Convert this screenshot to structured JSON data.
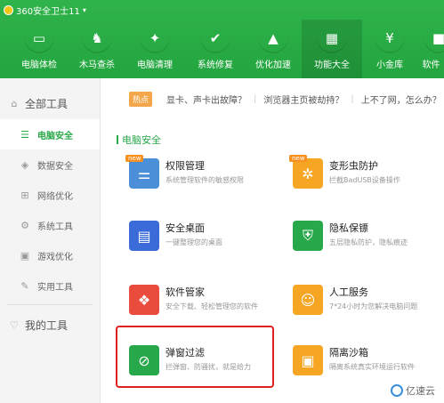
{
  "app": {
    "title": "360安全卫士11"
  },
  "nav": [
    {
      "label": "电脑体检",
      "icon": "monitor-icon",
      "color": "#4da3e8"
    },
    {
      "label": "木马查杀",
      "icon": "horse-icon",
      "color": "#8b6ad8"
    },
    {
      "label": "电脑清理",
      "icon": "broom-icon",
      "color": "#f6a623"
    },
    {
      "label": "系统修复",
      "icon": "shield-check-icon",
      "color": "#27a84a"
    },
    {
      "label": "优化加速",
      "icon": "rocket-icon",
      "color": "#3d8fe8"
    },
    {
      "label": "功能大全",
      "icon": "grid-icon",
      "color": "#f15a3a",
      "active": true
    },
    {
      "label": "小金库",
      "icon": "coin-icon",
      "color": "#f6a623"
    },
    {
      "label": "软件",
      "icon": "software-icon",
      "color": "#f15a3a"
    }
  ],
  "sidebar": {
    "all_tools": "全部工具",
    "items": [
      {
        "label": "电脑安全",
        "icon": "list-icon",
        "active": true
      },
      {
        "label": "数据安全",
        "icon": "shield-icon"
      },
      {
        "label": "网络优化",
        "icon": "network-icon"
      },
      {
        "label": "系统工具",
        "icon": "gear-icon"
      },
      {
        "label": "游戏优化",
        "icon": "gamepad-icon"
      },
      {
        "label": "实用工具",
        "icon": "wrench-icon"
      }
    ],
    "my_tools": "我的工具"
  },
  "hotbar": {
    "tag": "热点",
    "links": [
      "显卡、声卡出故障？",
      "浏览器主页被劫持？",
      "上不了网，怎么办？"
    ]
  },
  "section": {
    "title": "电脑安全"
  },
  "tools": [
    {
      "name": "权限管理",
      "desc": "系统管理软件的敏感权限",
      "icon": "permission-icon",
      "color": "#4a8fd8",
      "badge": "new"
    },
    {
      "name": "变形虫防护",
      "desc": "拦截BadUSB设备操作",
      "icon": "amoeba-icon",
      "color": "#f6a623",
      "badge": "new"
    },
    {
      "name": "安全桌面",
      "desc": "一键整理您的桌面",
      "icon": "desktop-icon",
      "color": "#3a6bd8"
    },
    {
      "name": "隐私保镖",
      "desc": "五层隐私防护，隐私痕迹",
      "icon": "privacy-icon",
      "color": "#27a84a"
    },
    {
      "name": "软件管家",
      "desc": "安全下载、轻松管理您的软件",
      "icon": "software-manager-icon",
      "color": "#e94b3c"
    },
    {
      "name": "人工服务",
      "desc": "7*24小时为您解决电脑问题",
      "icon": "agent-icon",
      "color": "#f6a623"
    },
    {
      "name": "弹窗过滤",
      "desc": "拦弹窗、防骚扰，就是给力",
      "icon": "popup-filter-icon",
      "color": "#27a84a"
    },
    {
      "name": "隔离沙箱",
      "desc": "隔离系统真实环境运行软件",
      "icon": "sandbox-icon",
      "color": "#f6a623"
    }
  ],
  "watermark": "亿速云"
}
